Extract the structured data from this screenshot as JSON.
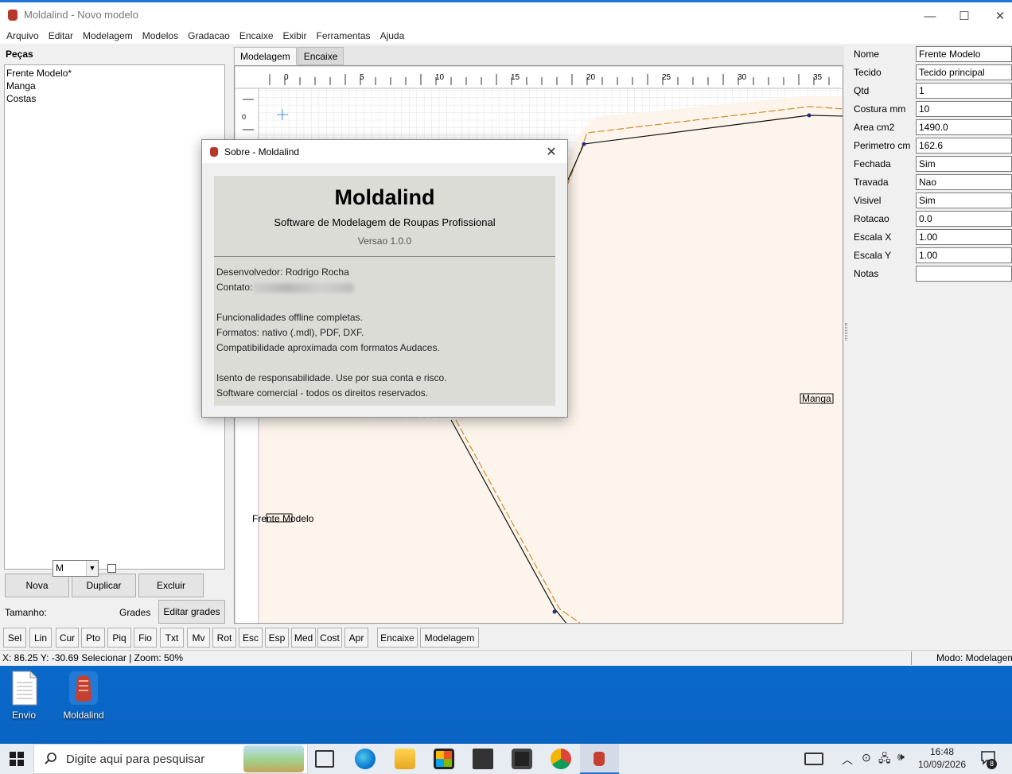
{
  "window": {
    "title": "Moldalind - Novo modelo",
    "minimize": "—",
    "maximize": "☐",
    "close": "✕"
  },
  "menu": [
    "Arquivo",
    "Editar",
    "Modelagem",
    "Modelos",
    "Gradacao",
    "Encaixe",
    "Exibir",
    "Ferramentas",
    "Ajuda"
  ],
  "left": {
    "header": "Peças",
    "pieces": [
      "Frente Modelo*",
      "Manga",
      "Costas"
    ],
    "buttons": {
      "new": "Nova",
      "duplicate": "Duplicar",
      "delete": "Excluir"
    },
    "size_label": "Tamanho:",
    "size_value": "M",
    "grades_label": "Grades",
    "edit_grades": "Editar grades"
  },
  "tabs": [
    "Modelagem",
    "Encaixe"
  ],
  "canvas": {
    "ruler_labels": [
      "0",
      "5",
      "10",
      "15",
      "20",
      "25",
      "30",
      "35"
    ],
    "vruler_label": "0",
    "piece_label_front": "Frente Modelo",
    "piece_label_sleeve": "Manga"
  },
  "properties": [
    {
      "key": "Nome",
      "value": "Frente Modelo"
    },
    {
      "key": "Tecido",
      "value": "Tecido principal"
    },
    {
      "key": "Qtd",
      "value": "1"
    },
    {
      "key": "Costura mm",
      "value": "10"
    },
    {
      "key": "Area cm2",
      "value": "1490.0"
    },
    {
      "key": "Perimetro cm",
      "value": "162.6"
    },
    {
      "key": "Fechada",
      "value": "Sim"
    },
    {
      "key": "Travada",
      "value": "Nao"
    },
    {
      "key": "Visivel",
      "value": "Sim"
    },
    {
      "key": "Rotacao",
      "value": "0.0"
    },
    {
      "key": "Escala X",
      "value": "1.00"
    },
    {
      "key": "Escala Y",
      "value": "1.00"
    },
    {
      "key": "Notas",
      "value": ""
    }
  ],
  "tools": [
    "Sel",
    "Lin",
    "Cur",
    "Pto",
    "Piq",
    "Fio",
    "Txt",
    "Mv",
    "Rot",
    "Esc",
    "Esp",
    "Med",
    "Cost",
    "Apr"
  ],
  "mode_buttons": [
    "Encaixe",
    "Modelagem"
  ],
  "status": {
    "left": "X: 86.25  Y: -30.69  Selecionar  |  Zoom: 50%",
    "right": "Modo: Modelagem"
  },
  "dialog": {
    "title": "Sobre - Moldalind",
    "app_name": "Moldalind",
    "subtitle": "Software de Modelagem de Roupas Profissional",
    "version": "Versao 1.0.0",
    "developer": "Desenvolvedor: Rodrigo Rocha",
    "contact_label": "Contato:",
    "features": "Funcionalidades offline completas.",
    "formats": "Formatos: nativo (.mdl), PDF, DXF.",
    "compat": "Compatibilidade aproximada com formatos Audaces.",
    "disclaimer": "Isento de responsabilidade. Use por sua conta e risco.",
    "copyright": "Software comercial - todos os direitos reservados."
  },
  "desktop": {
    "icons": [
      "Envio",
      "Moldalind"
    ]
  },
  "taskbar": {
    "search_placeholder": "Digite aqui para pesquisar",
    "time": "16:48",
    "date": "10/09/2026",
    "notifications": "8"
  }
}
